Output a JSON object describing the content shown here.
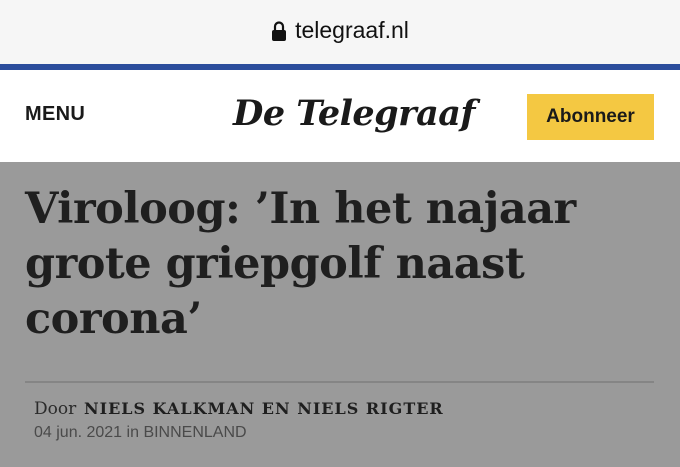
{
  "browser": {
    "url": "telegraaf.nl",
    "lock_icon": "lock-icon"
  },
  "colors": {
    "accent_line": "#2c4d9c",
    "subscribe_bg": "#f4c842",
    "article_bg": "#9a9a9a"
  },
  "header": {
    "menu_label": "MENU",
    "logo_text": "De Telegraaf",
    "subscribe_label": "Abonneer"
  },
  "article": {
    "headline": "Viroloog: ’In het najaar grote griepgolf naast corona’",
    "byline_prefix": "Door",
    "authors": "NIELS KALKMAN EN NIELS RIGTER",
    "date": "04 jun. 2021",
    "category_prefix": "in",
    "category": "BINNENLAND"
  }
}
